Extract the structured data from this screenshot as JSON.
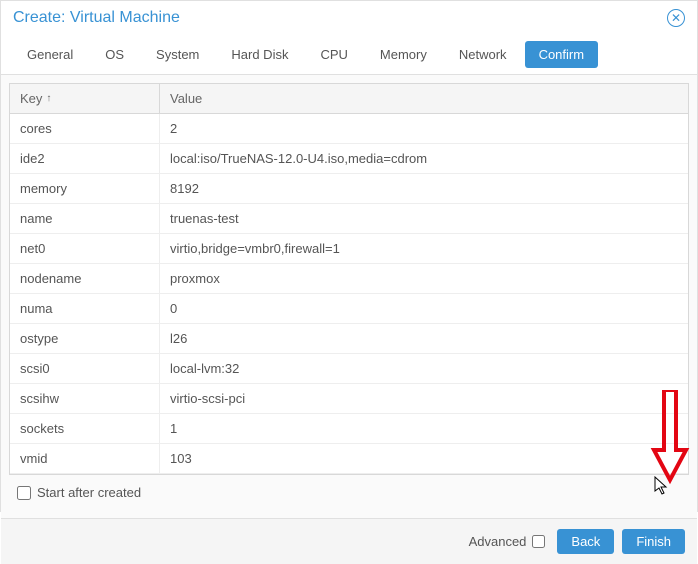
{
  "title": "Create: Virtual Machine",
  "tabs": {
    "general": "General",
    "os": "OS",
    "system": "System",
    "harddisk": "Hard Disk",
    "cpu": "CPU",
    "memory": "Memory",
    "network": "Network",
    "confirm": "Confirm"
  },
  "grid": {
    "header_key": "Key",
    "header_value": "Value",
    "rows": [
      {
        "key": "cores",
        "value": "2"
      },
      {
        "key": "ide2",
        "value": "local:iso/TrueNAS-12.0-U4.iso,media=cdrom"
      },
      {
        "key": "memory",
        "value": "8192"
      },
      {
        "key": "name",
        "value": "truenas-test"
      },
      {
        "key": "net0",
        "value": "virtio,bridge=vmbr0,firewall=1"
      },
      {
        "key": "nodename",
        "value": "proxmox"
      },
      {
        "key": "numa",
        "value": "0"
      },
      {
        "key": "ostype",
        "value": "l26"
      },
      {
        "key": "scsi0",
        "value": "local-lvm:32"
      },
      {
        "key": "scsihw",
        "value": "virtio-scsi-pci"
      },
      {
        "key": "sockets",
        "value": "1"
      },
      {
        "key": "vmid",
        "value": "103"
      }
    ]
  },
  "start_after_label": "Start after created",
  "footer": {
    "advanced_label": "Advanced",
    "back_label": "Back",
    "finish_label": "Finish"
  }
}
